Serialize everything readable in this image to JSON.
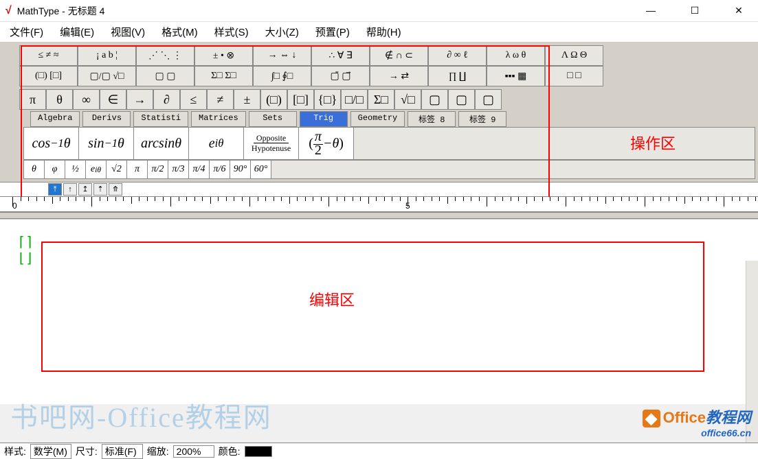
{
  "title": "MathType - 无标题 4",
  "menu": [
    "文件(F)",
    "编辑(E)",
    "视图(V)",
    "格式(M)",
    "样式(S)",
    "大小(Z)",
    "预置(P)",
    "帮助(H)"
  ],
  "palette_row1": [
    "≤ ≠ ≈",
    "¡ a b ¦",
    "⋰ ⋱ ⋮",
    "± • ⊗",
    "→ ⇔ ↓",
    "∴ ∀ ∃",
    "∉ ∩ ⊂",
    "∂ ∞ ℓ",
    "λ ω θ",
    "Λ Ω Θ"
  ],
  "palette_row2": [
    "(□) [□]",
    "▢/▢ √□",
    "▢ ▢",
    "Σ□ Σ□",
    "∫□ ∮□",
    "▢̄ ▢⃗",
    "→ ⇄",
    "∏ ∐",
    "▪▪▪ ▦",
    "□ □"
  ],
  "palette_row3": [
    "π",
    "θ",
    "∞",
    "∈",
    "→",
    "∂",
    "≤",
    "≠",
    "±",
    "(□)",
    "[□]",
    "{□}",
    "□/□",
    "Σ□",
    "√□",
    "▢",
    "▢",
    "▢"
  ],
  "tabs": [
    {
      "label": "Algebra",
      "active": false
    },
    {
      "label": "Derivs",
      "active": false
    },
    {
      "label": "Statisti",
      "active": false
    },
    {
      "label": "Matrices",
      "active": false
    },
    {
      "label": "Sets",
      "active": false
    },
    {
      "label": "Trig",
      "active": true
    },
    {
      "label": "Geometry",
      "active": false
    },
    {
      "label": "标签 8",
      "active": false
    },
    {
      "label": "标签 9",
      "active": false
    }
  ],
  "big_buttons": [
    {
      "html": "cos<sup>−1</sup> <i>θ</i>"
    },
    {
      "html": "sin<sup>−1</sup> <i>θ</i>"
    },
    {
      "html": "arcsin<i>θ</i>"
    },
    {
      "html": "<i>e</i><sup><i>iθ</i></sup>"
    },
    {
      "html": "<span style='font-size:12px;font-style:normal;text-align:center'><span style='border-bottom:1px solid #000;padding:0 4px'>Opposite</span><br>Hypotenuse</span>"
    },
    {
      "html": "<span style='font-style:normal'>(</span><span style='display:inline-block;text-align:center;vertical-align:middle;font-style:normal;line-height:1'><span style='border-bottom:1px solid #000;padding:0 2px'><i>π</i></span><br>2</span> − <i>θ</i><span style='font-style:normal'>)</span>"
    }
  ],
  "small_buttons": [
    "θ",
    "φ",
    "½",
    "e<sup>iθ</sup>",
    "√2",
    "π",
    "π/2",
    "π/3",
    "π/4",
    "π/6",
    "90°",
    "60°"
  ],
  "ruler_marks": [
    "0",
    "5"
  ],
  "region_labels": {
    "operation": "操作区",
    "edit": "编辑区"
  },
  "watermark": "书吧网-Office教程网",
  "logo": {
    "brand": "Office",
    "suffix": "教程网",
    "sub": "office66.cn"
  },
  "status": {
    "style_label": "样式:",
    "style_value": "数学(M)",
    "size_label": "尺寸:",
    "size_value": "标准(F)",
    "zoom_label": "缩放:",
    "zoom_value": "200%",
    "color_label": "颜色:"
  }
}
